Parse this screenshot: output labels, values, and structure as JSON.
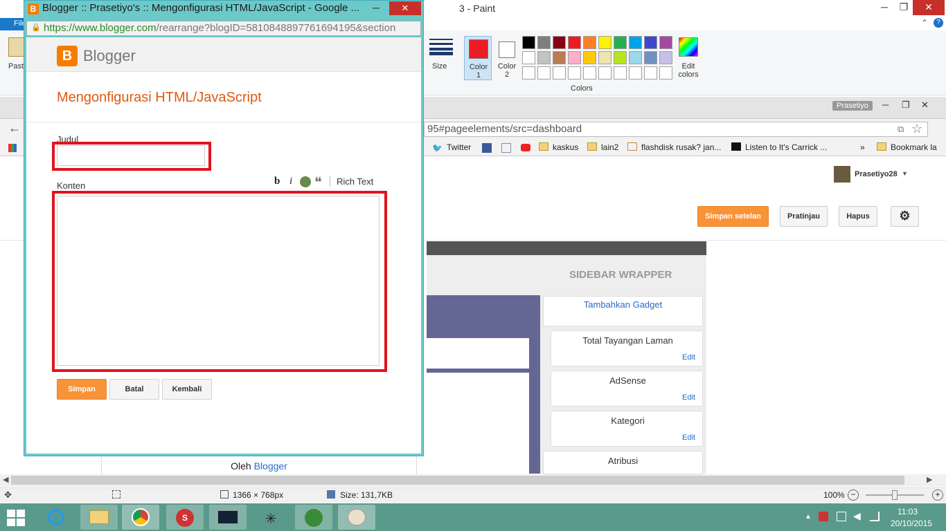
{
  "paint": {
    "title": "3 - Paint",
    "file_tab": "File",
    "paste_label": "Paste",
    "size_label": "Size",
    "color1_label": "Color",
    "color1_num": "1",
    "color2_label": "Color",
    "color2_num": "2",
    "colors_group": "Colors",
    "edit_colors_1": "Edit",
    "edit_colors_2": "colors",
    "palette": [
      "#000000",
      "#7f7f7f",
      "#880015",
      "#ed1c24",
      "#ff7f27",
      "#fff200",
      "#22b14c",
      "#00a2e8",
      "#3f48cc",
      "#a349a4",
      "#ffffff",
      "#c3c3c3",
      "#b97a57",
      "#ffaec9",
      "#ffc90e",
      "#efe4b0",
      "#b5e61d",
      "#99d9ea",
      "#7092be",
      "#c8bfe7"
    ],
    "color1": "#ed1c24",
    "color2": "#ffffff",
    "status": {
      "dimensions": "1366 × 768px",
      "size": "Size: 131,7KB",
      "zoom": "100%"
    }
  },
  "chrome": {
    "profile_badge": "Prasetiyo",
    "url_fragment": "95#pageelements/src=dashboard",
    "bookmarks": [
      "Twitter",
      "kaskus",
      "lain2",
      "flashdisk rusak? jan...",
      "Listen to It's Carrick ...",
      "»",
      "Bookmark la"
    ],
    "user_name": "Prasetiyo28",
    "buttons": {
      "save_settings": "Simpan setelan",
      "preview": "Pratinjau",
      "delete": "Hapus"
    },
    "layout": {
      "sidebar_title": "SIDEBAR WRAPPER",
      "add_gadget": "Tambahkan Gadget",
      "gadgets": [
        {
          "name": "Total Tayangan Laman",
          "edit": "Edit"
        },
        {
          "name": "AdSense",
          "edit": "Edit"
        },
        {
          "name": "Kategori",
          "edit": "Edit"
        },
        {
          "name": "Atribusi",
          "edit": ""
        }
      ],
      "footer_prefix": "Oleh",
      "footer_link": "Blogger"
    }
  },
  "popup": {
    "window_title": "Blogger :: Prasetiyo's :: Mengonfigurasi HTML/JavaScript - Google ...",
    "url_secure": "https://www.blogger.com",
    "url_rest": "/rearrange?blogID=5810848897761694195&section",
    "brand": "Blogger",
    "heading": "Mengonfigurasi HTML/JavaScript",
    "title_label": "Judul",
    "title_value": "",
    "content_label": "Konten",
    "content_value": "",
    "toolbar": {
      "bold": "b",
      "italic": "i",
      "rich_text": "Rich Text"
    },
    "buttons": {
      "save": "Simpan",
      "cancel": "Batal",
      "back": "Kembali"
    }
  },
  "taskbar": {
    "time": "11:03",
    "date": "20/10/2015"
  }
}
